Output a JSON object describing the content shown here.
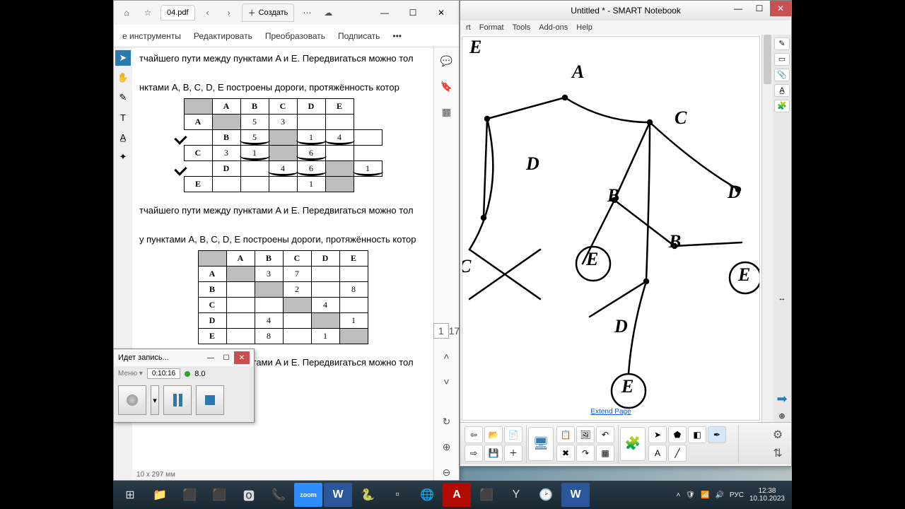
{
  "pdf": {
    "filename": "04.pdf",
    "create_tab": "Создать",
    "menu": {
      "tools": "е инструменты",
      "edit": "Редактировать",
      "convert": "Преобразовать",
      "sign": "Подписать"
    },
    "text1": "тчайшего пути между пунктами A и E. Передвигаться можно тол",
    "text2": "нктами A, B, C, D, E построены дороги, протяжённость котор",
    "text3": "тчайшего пути между пунктами A и E. Передвигаться можно тол",
    "text4": "у пунктами A, B, C, D, E построены дороги, протяжённость котор",
    "text5": "тчайшего пути между пунктами A и E. Передвигаться можно тол",
    "table1": {
      "headers": [
        "",
        "A",
        "B",
        "C",
        "D",
        "E"
      ],
      "rows": [
        [
          "A",
          "",
          "5",
          "3",
          "",
          ""
        ],
        [
          "B",
          "5",
          "",
          "1",
          "4",
          ""
        ],
        [
          "C",
          "3",
          "1",
          "",
          "6",
          ""
        ],
        [
          "D",
          "",
          "4",
          "6",
          "",
          "1"
        ],
        [
          "E",
          "",
          "",
          "",
          "1",
          ""
        ]
      ]
    },
    "table2": {
      "headers": [
        "",
        "A",
        "B",
        "C",
        "D",
        "E"
      ],
      "rows": [
        [
          "A",
          "",
          "3",
          "7",
          "",
          ""
        ],
        [
          "B",
          "",
          "",
          "2",
          "",
          "8"
        ],
        [
          "C",
          "",
          "",
          "",
          "4",
          ""
        ],
        [
          "D",
          "",
          "4",
          "",
          "",
          "1"
        ],
        [
          "E",
          "",
          "8",
          "",
          "1",
          ""
        ]
      ]
    },
    "page_current": "1",
    "page_total": "17",
    "status": "10 x 297 мм"
  },
  "recorder": {
    "title": "Идет запись...",
    "time": "0:10:16",
    "level": "8.0"
  },
  "smart": {
    "title": "Untitled * - SMART Notebook",
    "menu": {
      "insert": "rt",
      "format": "Format",
      "tools": "Tools",
      "addons": "Add-ons",
      "help": "Help"
    },
    "extend": "Extend Page",
    "labels": {
      "A": "A",
      "B": "B",
      "C": "C",
      "D": "D",
      "E": "E"
    }
  },
  "taskbar": {
    "lang": "РУС",
    "time": "12:38",
    "date": "10.10.2023"
  }
}
